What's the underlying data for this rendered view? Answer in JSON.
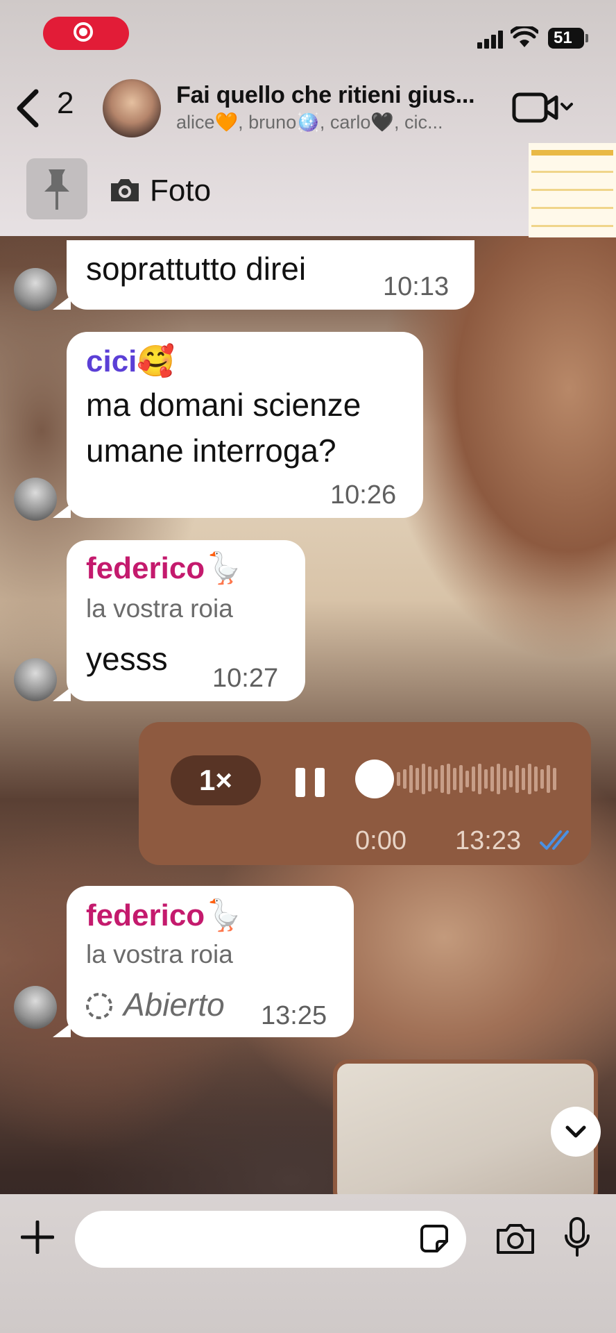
{
  "status_bar": {
    "battery": "51",
    "icons": [
      "screen-record-icon",
      "cellular-signal-icon",
      "wifi-icon",
      "battery-icon"
    ]
  },
  "header": {
    "back_count": "2",
    "title": "Fai quello che ritieni gius...",
    "members": "alice🧡, bruno🪩, carlo🖤, cic...",
    "video_icon": "video-call-icon"
  },
  "pinned": {
    "label": "Foto"
  },
  "messages": [
    {
      "text": "soprattutto direi",
      "time": "10:13"
    },
    {
      "sender": "cici🥰",
      "sender_color": "#5b3fd6",
      "text_line1": "ma domani scienze",
      "text_line2": "umane interroga?",
      "time": "10:26"
    },
    {
      "sender": "federico🪿",
      "sender_color": "#c41a6d",
      "quote": "la vostra roia",
      "text": "yesss",
      "time": "10:27"
    },
    {
      "type": "voice",
      "speed": "1×",
      "elapsed": "0:00",
      "time": "13:23"
    },
    {
      "sender": "federico🪿",
      "sender_color": "#c41a6d",
      "quote": "la vostra roia",
      "text": "Abierto",
      "time": "13:25"
    }
  ],
  "composer": {
    "placeholder": ""
  },
  "colors": {
    "record_red": "#e21c37",
    "voice_bubble": "#8e5a40",
    "read_receipt": "#4a90e2"
  }
}
